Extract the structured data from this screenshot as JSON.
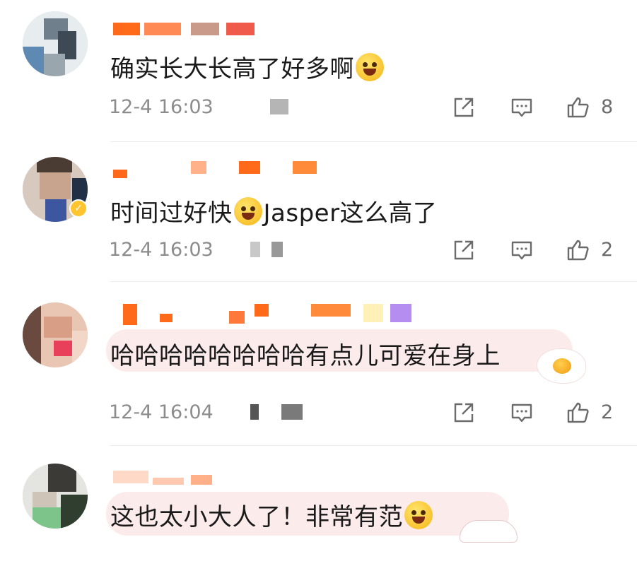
{
  "comments": [
    {
      "text": "确实长大长高了好多啊",
      "timestamp": "12-4 16:03",
      "likes": "8",
      "emoji": "laughing-crying-face-icon"
    },
    {
      "text_before": "时间过好快",
      "text_after": "Jasper这么高了",
      "timestamp": "12-4 16:03",
      "likes": "2",
      "emoji": "tears-of-joy-face-icon"
    },
    {
      "text": "哈哈哈哈哈哈哈哈有点儿可爱在身上",
      "timestamp": "12-4 16:04",
      "likes": "2"
    },
    {
      "text": "这也太小大人了！非常有范",
      "emoji": "shy-smile-face-icon"
    }
  ],
  "colors": {
    "text": "#1a1a1a",
    "meta": "#8c8c8c",
    "accent_orange": "#ff6a1a",
    "badge_gold": "#ffc42e",
    "divider": "#ececec"
  }
}
